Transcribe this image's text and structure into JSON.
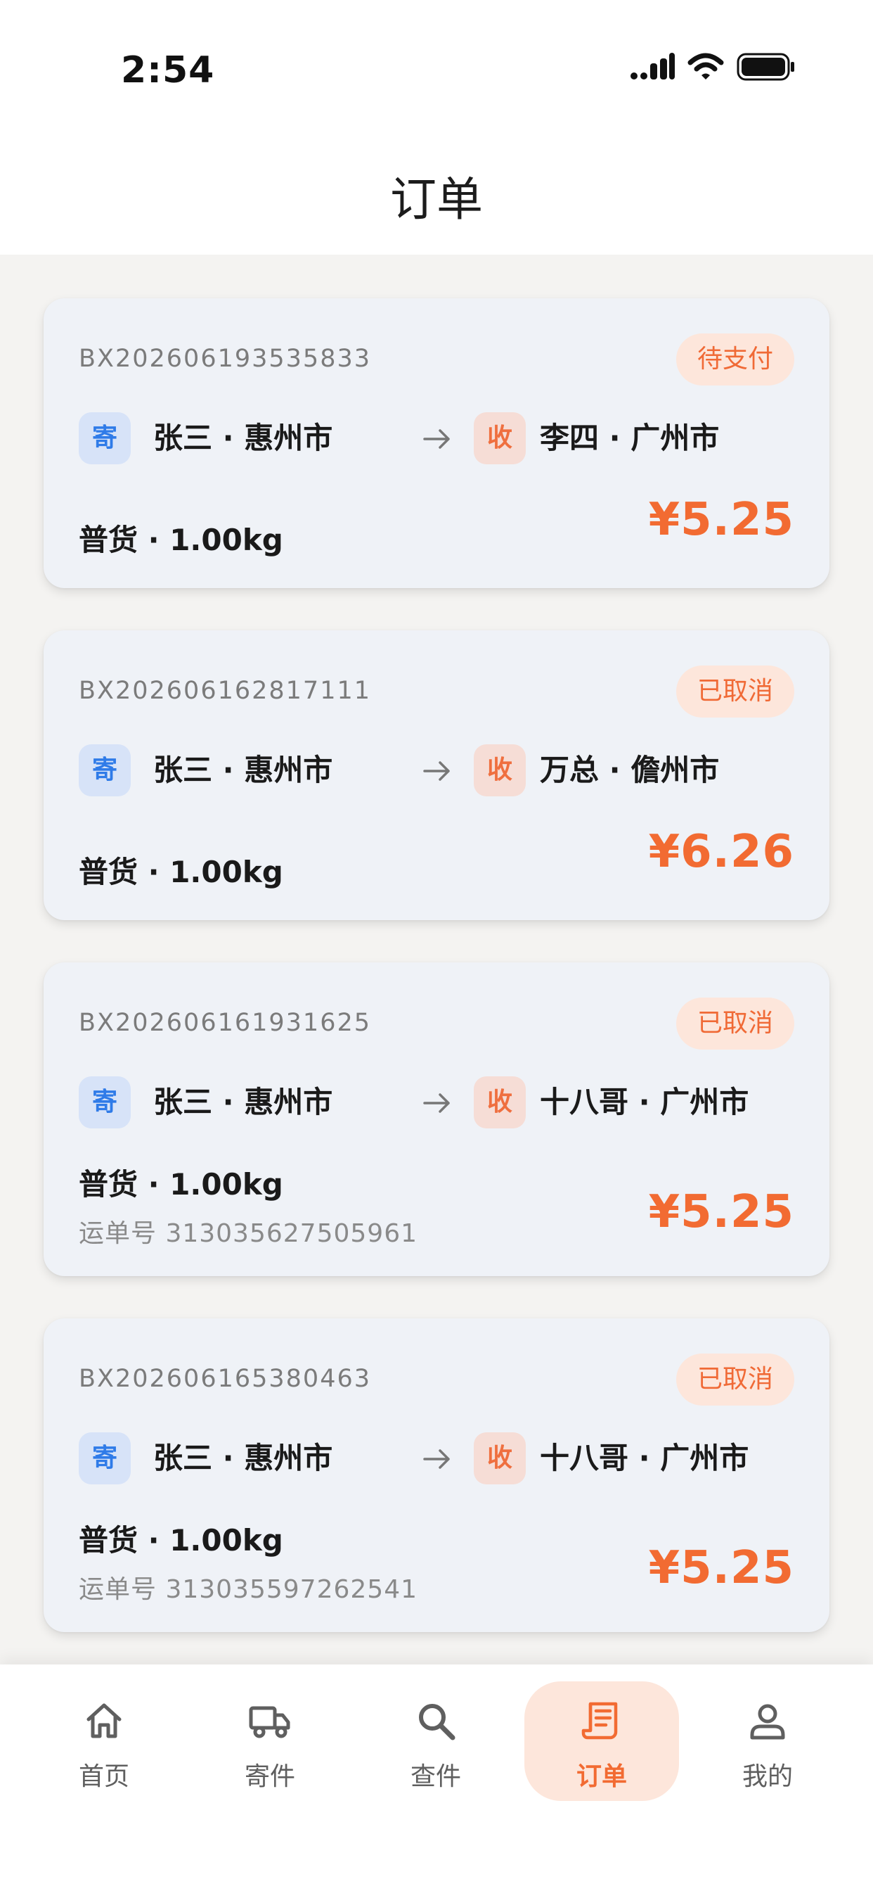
{
  "status_bar": {
    "time": "2:54"
  },
  "header": {
    "title": "订单"
  },
  "orders": [
    {
      "order_no": "BX202606193535833",
      "status": "待支付",
      "send_tag": "寄",
      "sender": "张三 · 惠州市",
      "recv_tag": "收",
      "receiver": "李四 · 广州市",
      "goods": "普货 · 1.00kg",
      "price": "¥5.25"
    },
    {
      "order_no": "BX202606162817111",
      "status": "已取消",
      "send_tag": "寄",
      "sender": "张三 · 惠州市",
      "recv_tag": "收",
      "receiver": "万总 · 儋州市",
      "goods": "普货 · 1.00kg",
      "price": "¥6.26"
    },
    {
      "order_no": "BX202606161931625",
      "status": "已取消",
      "send_tag": "寄",
      "sender": "张三 · 惠州市",
      "recv_tag": "收",
      "receiver": "十八哥 · 广州市",
      "goods": "普货 · 1.00kg",
      "waybill": "运单号 313035627505961",
      "price": "¥5.25"
    },
    {
      "order_no": "BX202606165380463",
      "status": "已取消",
      "send_tag": "寄",
      "sender": "张三 · 惠州市",
      "recv_tag": "收",
      "receiver": "十八哥 · 广州市",
      "goods": "普货 · 1.00kg",
      "waybill": "运单号 313035597262541",
      "price": "¥5.25"
    }
  ],
  "tabbar": {
    "items": [
      {
        "label": "首页",
        "icon": "home-icon",
        "active": false
      },
      {
        "label": "寄件",
        "icon": "truck-icon",
        "active": false
      },
      {
        "label": "查件",
        "icon": "search-icon",
        "active": false
      },
      {
        "label": "订单",
        "icon": "receipt-icon",
        "active": true
      },
      {
        "label": "我的",
        "icon": "person-icon",
        "active": false
      }
    ]
  },
  "colors": {
    "accent": "#f26b32",
    "active_tab_bg": "#fde6db",
    "send_tag": "#2f7be8",
    "card_bg": "#eff2f7"
  }
}
